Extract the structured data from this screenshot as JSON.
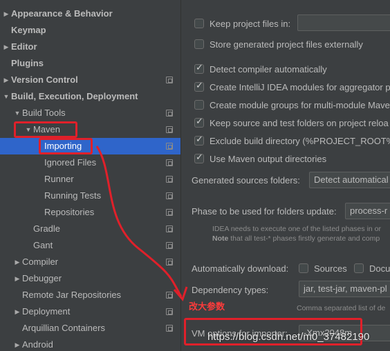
{
  "tree": {
    "items": [
      {
        "label": "Appearance & Behavior",
        "bold": true,
        "expandable": true,
        "expanded": false,
        "config": false
      },
      {
        "label": "Keymap",
        "bold": true,
        "expandable": false,
        "config": false
      },
      {
        "label": "Editor",
        "bold": true,
        "expandable": true,
        "expanded": false,
        "config": false
      },
      {
        "label": "Plugins",
        "bold": true,
        "expandable": false,
        "config": false
      },
      {
        "label": "Version Control",
        "bold": true,
        "expandable": true,
        "expanded": false,
        "config": true
      },
      {
        "label": "Build, Execution, Deployment",
        "bold": true,
        "expandable": true,
        "expanded": true,
        "config": false
      },
      {
        "label": "Build Tools",
        "bold": false,
        "expandable": true,
        "expanded": true,
        "config": true
      },
      {
        "label": "Maven",
        "bold": false,
        "expandable": true,
        "expanded": true,
        "config": true
      },
      {
        "label": "Importing",
        "bold": false,
        "expandable": false,
        "config": true,
        "selected": true
      },
      {
        "label": "Ignored Files",
        "bold": false,
        "expandable": false,
        "config": true
      },
      {
        "label": "Runner",
        "bold": false,
        "expandable": false,
        "config": true
      },
      {
        "label": "Running Tests",
        "bold": false,
        "expandable": false,
        "config": true
      },
      {
        "label": "Repositories",
        "bold": false,
        "expandable": false,
        "config": true
      },
      {
        "label": "Gradle",
        "bold": false,
        "expandable": false,
        "config": true
      },
      {
        "label": "Gant",
        "bold": false,
        "expandable": false,
        "config": true
      },
      {
        "label": "Compiler",
        "bold": false,
        "expandable": true,
        "expanded": false,
        "config": true
      },
      {
        "label": "Debugger",
        "bold": false,
        "expandable": true,
        "expanded": false,
        "config": false
      },
      {
        "label": "Remote Jar Repositories",
        "bold": false,
        "expandable": false,
        "config": true
      },
      {
        "label": "Deployment",
        "bold": false,
        "expandable": true,
        "expanded": false,
        "config": true
      },
      {
        "label": "Arquillian Containers",
        "bold": false,
        "expandable": false,
        "config": true
      },
      {
        "label": "Android",
        "bold": false,
        "expandable": true,
        "expanded": false,
        "config": false
      }
    ]
  },
  "settings": {
    "keep_project_files": {
      "label": "Keep project files in:",
      "checked": false,
      "value": ""
    },
    "store_external": {
      "label": "Store generated project files externally",
      "checked": false
    },
    "detect_compiler": {
      "label": "Detect compiler automatically",
      "checked": true
    },
    "create_modules": {
      "label": "Create IntelliJ IDEA modules for aggregator pr",
      "checked": true
    },
    "module_groups": {
      "label": "Create module groups for multi-module Mave",
      "checked": false
    },
    "keep_source": {
      "label": "Keep source and test folders on project reloa",
      "checked": true
    },
    "exclude_build": {
      "label": "Exclude build directory (%PROJECT_ROOT%/",
      "checked": true
    },
    "use_output": {
      "label": "Use Maven output directories",
      "checked": true
    },
    "generated_sources": {
      "label": "Generated sources folders:",
      "value": "Detect automatical"
    },
    "phase": {
      "label": "Phase to be used for folders update:",
      "value": "process-r"
    },
    "phase_note_1": "IDEA needs to execute one of the listed phases in or",
    "phase_note_2_bold": "Note",
    "phase_note_2": " that all test-* phases firstly generate and comp",
    "auto_download": {
      "label": "Automatically download:",
      "sources": "Sources",
      "docs": "Docu"
    },
    "dependency_types": {
      "label": "Dependency types:",
      "value": "jar, test-jar, maven-pl",
      "hint": "Comma separated list of de"
    },
    "vm_options": {
      "label": "VM options for importer:",
      "value": "-Xmx2048m"
    }
  },
  "annotation": {
    "text": "改大参数",
    "color": "#e0202a"
  },
  "watermark": "https://blog.csdn.net/m0_37482190"
}
